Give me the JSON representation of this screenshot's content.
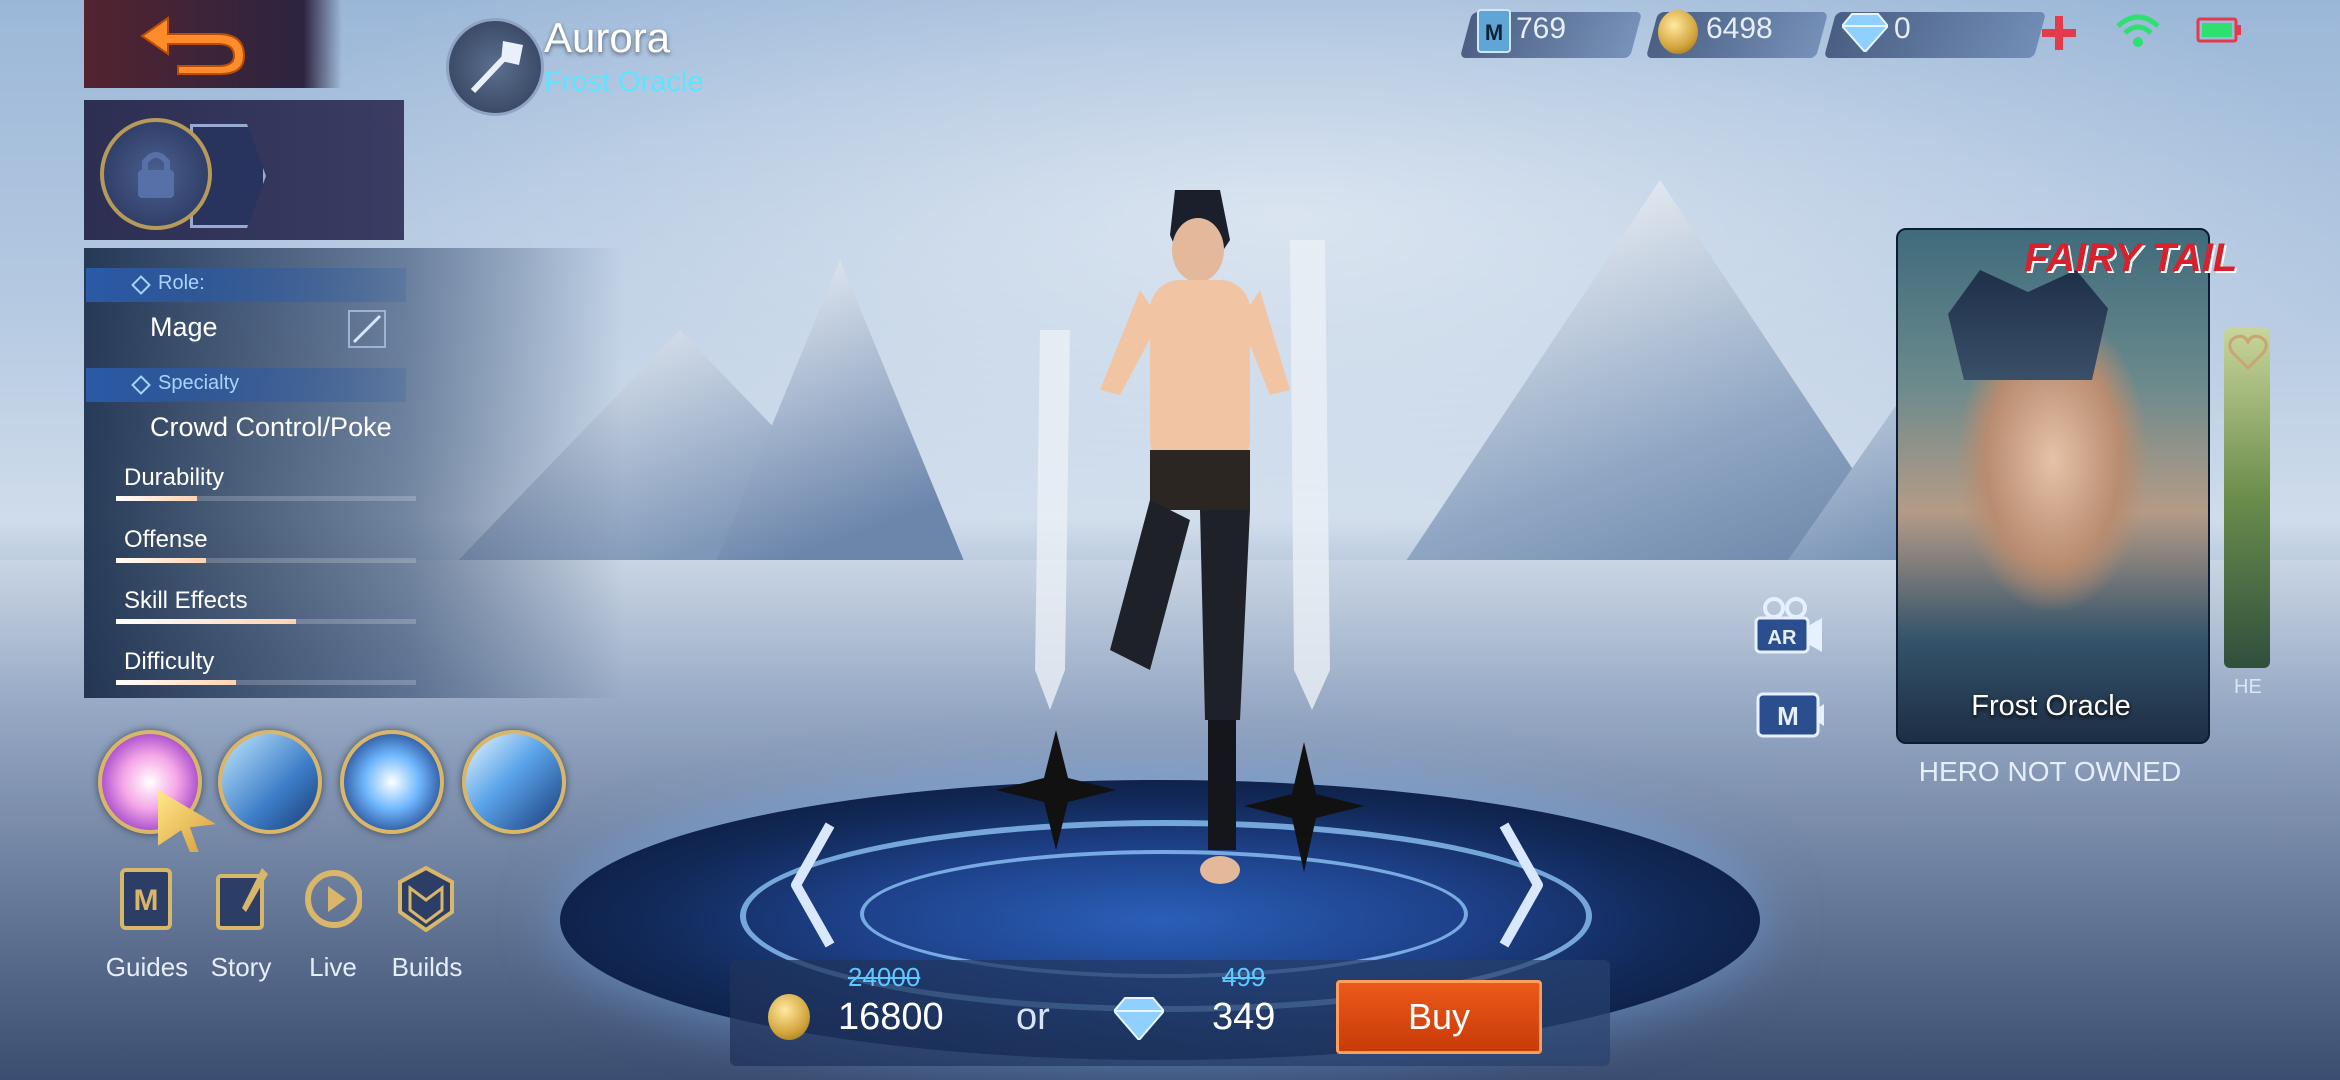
{
  "hero": {
    "name": "Aurora",
    "skin": "Frost Oracle"
  },
  "resources": {
    "ticket": "769",
    "battle_points": "6498",
    "diamonds": "0"
  },
  "info": {
    "role_label": "Role:",
    "role_value": "Mage",
    "specialty_label": "Specialty",
    "specialty_value": "Crowd Control/Poke",
    "stats": [
      {
        "name": "Durability",
        "level": 0.27
      },
      {
        "name": "Offense",
        "level": 0.3
      },
      {
        "name": "Skill Effects",
        "level": 0.6
      },
      {
        "name": "Difficulty",
        "level": 0.4
      }
    ]
  },
  "bottom_nav": [
    {
      "label": "Guides",
      "icon": "book-m-icon"
    },
    {
      "label": "Story",
      "icon": "quill-book-icon"
    },
    {
      "label": "Live",
      "icon": "play-icon"
    },
    {
      "label": "Builds",
      "icon": "helmet-icon"
    }
  ],
  "purchase": {
    "bp_old": "24000",
    "bp_price": "16800",
    "or_text": "or",
    "dia_old": "499",
    "dia_price": "349",
    "buy_label": "Buy"
  },
  "card": {
    "brand": "FAIRY TAIL",
    "skin_name": "Frost Oracle",
    "status": "HERO NOT OWNED",
    "next_partial": "HE"
  },
  "side_buttons": {
    "ar": "AR",
    "m": "M"
  },
  "colors": {
    "accent_cyan": "#5fe4ff",
    "buy": "#d9470f",
    "panel": "#1f3a66"
  }
}
